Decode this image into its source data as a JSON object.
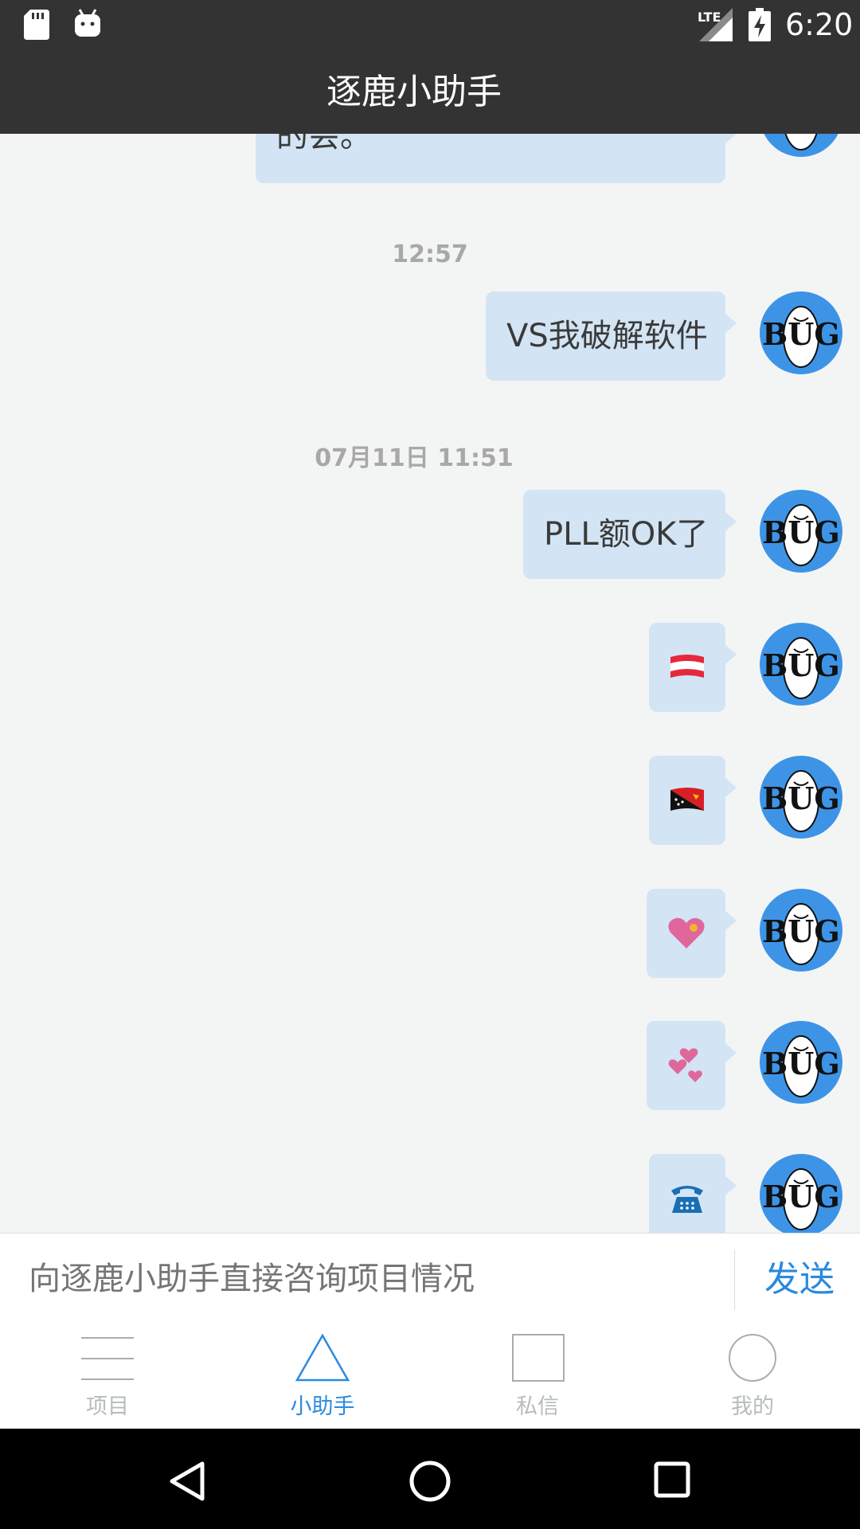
{
  "status_bar": {
    "network": "LTE",
    "time": "6:20",
    "icons": [
      "sd-card-icon",
      "android-icon",
      "signal-icon",
      "battery-charging-icon"
    ]
  },
  "header": {
    "title": "逐鹿小助手"
  },
  "chat": {
    "partial_message": "的会。",
    "timestamps": [
      "12:57",
      "07月11日 11:51"
    ],
    "messages": [
      {
        "type": "text",
        "text": "VS我破解软件"
      },
      {
        "type": "text",
        "text": "PLL额OK了"
      },
      {
        "type": "emoji",
        "emoji": "🇦🇹"
      },
      {
        "type": "emoji",
        "emoji": "🇵🇬"
      },
      {
        "type": "emoji",
        "emoji": "💟"
      },
      {
        "type": "emoji",
        "emoji": "💕"
      },
      {
        "type": "emoji",
        "emoji": "☎️"
      }
    ],
    "avatar_text": "BUG"
  },
  "input": {
    "placeholder": "向逐鹿小助手直接咨询项目情况",
    "send_label": "发送"
  },
  "tabs": [
    {
      "label": "项目",
      "icon": "menu-lines-icon",
      "active": false
    },
    {
      "label": "小助手",
      "icon": "triangle-icon",
      "active": true
    },
    {
      "label": "私信",
      "icon": "square-icon",
      "active": false
    },
    {
      "label": "我的",
      "icon": "circle-icon",
      "active": false
    }
  ],
  "colors": {
    "accent": "#2a8ae0",
    "header_bg": "#333333",
    "bubble_bg": "#d3e4f4",
    "chat_bg": "#f3f5f5",
    "tab_inactive": "#b6bcbc"
  }
}
